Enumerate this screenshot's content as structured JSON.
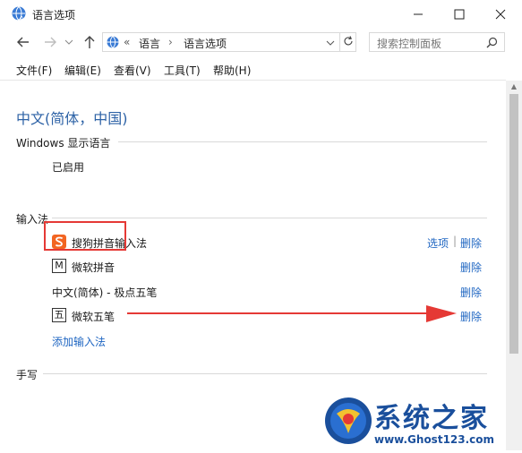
{
  "window": {
    "title": "语言选项"
  },
  "nav": {
    "breadcrumb_root": "«",
    "breadcrumb_1": "语言",
    "breadcrumb_sep": "›",
    "breadcrumb_2": "语言选项",
    "search_placeholder": "搜索控制面板"
  },
  "menu": {
    "file": "文件(F)",
    "edit": "编辑(E)",
    "view": "查看(V)",
    "tools": "工具(T)",
    "help": "帮助(H)"
  },
  "content": {
    "language_title": "中文(简体，中国)",
    "display_section": "Windows 显示语言",
    "display_status": "已启用",
    "ime_section": "输入法",
    "ime_items": [
      {
        "label": "搜狗拼音输入法",
        "options_link": "选项",
        "remove_link": "删除"
      },
      {
        "label": "微软拼音",
        "icon_text": "M",
        "remove_link": "删除"
      },
      {
        "label": "中文(简体) - 极点五笔",
        "remove_link": "删除"
      },
      {
        "label": "微软五笔",
        "icon_text": "五",
        "remove_link": "删除"
      }
    ],
    "ime_separator": "|",
    "add_ime_link": "添加输入法",
    "handwriting_section": "手写"
  },
  "watermark": {
    "text": "系统之家",
    "url": "www.Ghost123.com"
  },
  "colors": {
    "link": "#1f66c2",
    "title_blue": "#2d62a6",
    "annotation_red": "#e53935",
    "sogou_orange": "#f26522"
  }
}
